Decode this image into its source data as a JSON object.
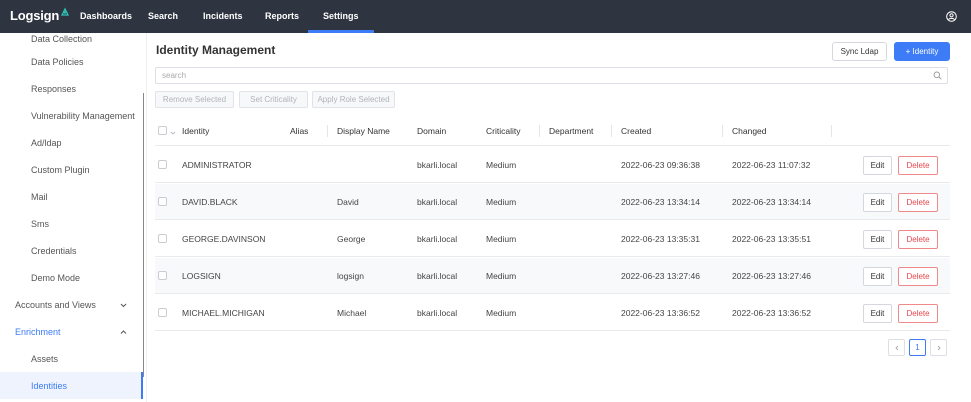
{
  "app": {
    "logo_text": "Logsign",
    "accent_color": "#3d7bf7",
    "topbar_color": "#2f3540"
  },
  "nav": {
    "items": [
      {
        "label": "Dashboards"
      },
      {
        "label": "Search"
      },
      {
        "label": "Incidents"
      },
      {
        "label": "Reports"
      },
      {
        "label": "Settings",
        "active": true
      }
    ],
    "user_icon": "user-circle-icon"
  },
  "sidebar": {
    "items": [
      {
        "label": "Data Collection"
      },
      {
        "label": "Data Policies"
      },
      {
        "label": "Responses"
      },
      {
        "label": "Vulnerability Management"
      },
      {
        "label": "Ad/ldap"
      },
      {
        "label": "Custom Plugin"
      },
      {
        "label": "Mail"
      },
      {
        "label": "Sms"
      },
      {
        "label": "Credentials"
      },
      {
        "label": "Demo Mode"
      },
      {
        "label": "Accounts and Views"
      },
      {
        "label": "Enrichment"
      },
      {
        "label": "Assets"
      },
      {
        "label": "Identities"
      }
    ]
  },
  "main": {
    "title": "Identity Management",
    "sync_label": "Sync Ldap",
    "add_label": "+ Identity",
    "search_placeholder": "search",
    "bulk_actions": {
      "remove": "Remove Selected",
      "criticality": "Set Criticality",
      "role": "Apply Role Selected"
    }
  },
  "table": {
    "columns": {
      "identity": "Identity",
      "alias": "Alias",
      "display_name": "Display Name",
      "domain": "Domain",
      "criticality": "Criticality",
      "department": "Department",
      "created": "Created",
      "changed": "Changed"
    },
    "edit_label": "Edit",
    "delete_label": "Delete",
    "rows": [
      {
        "identity": "ADMINISTRATOR",
        "alias": "",
        "display_name": "",
        "domain": "bkarli.local",
        "criticality": "Medium",
        "department": "",
        "created": "2022-06-23 09:36:38",
        "changed": "2022-06-23 11:07:32"
      },
      {
        "identity": "DAVID.BLACK",
        "alias": "",
        "display_name": "David",
        "domain": "bkarli.local",
        "criticality": "Medium",
        "department": "",
        "created": "2022-06-23 13:34:14",
        "changed": "2022-06-23 13:34:14"
      },
      {
        "identity": "GEORGE.DAVINSON",
        "alias": "",
        "display_name": "George",
        "domain": "bkarli.local",
        "criticality": "Medium",
        "department": "",
        "created": "2022-06-23 13:35:31",
        "changed": "2022-06-23 13:35:51"
      },
      {
        "identity": "LOGSIGN",
        "alias": "",
        "display_name": "logsign",
        "domain": "bkarli.local",
        "criticality": "Medium",
        "department": "",
        "created": "2022-06-23 13:27:46",
        "changed": "2022-06-23 13:27:46"
      },
      {
        "identity": "MICHAEL.MICHIGAN",
        "alias": "",
        "display_name": "Michael",
        "domain": "bkarli.local",
        "criticality": "Medium",
        "department": "",
        "created": "2022-06-23 13:36:52",
        "changed": "2022-06-23 13:36:52"
      }
    ]
  },
  "pagination": {
    "current_page": "1"
  }
}
